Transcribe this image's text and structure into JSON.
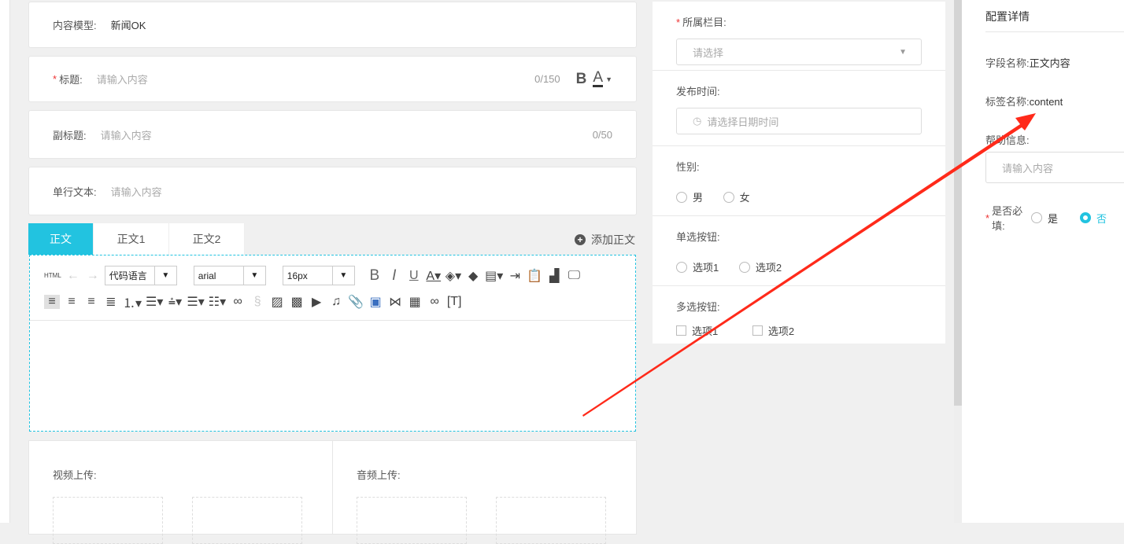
{
  "left": {
    "content_model": {
      "label": "内容模型:",
      "value": "新闻OK"
    },
    "title": {
      "label": "标题:",
      "placeholder": "请输入内容",
      "count": "0/150",
      "bold": "B",
      "color": "A"
    },
    "subtitle": {
      "label": "副标题:",
      "placeholder": "请输入内容",
      "count": "0/50"
    },
    "single_text": {
      "label": "单行文本:",
      "placeholder": "请输入内容"
    },
    "tabs": [
      "正文",
      "正文1",
      "正文2"
    ],
    "add_body": "添加正文",
    "toolbar": {
      "html": "HTML",
      "code_lang": "代码语言",
      "font": "arial",
      "size": "16px"
    },
    "video_upload": "视频上传:",
    "audio_upload": "音频上传:"
  },
  "middle": {
    "column": {
      "label": "所属栏目:",
      "placeholder": "请选择"
    },
    "publish_time": {
      "label": "发布时间:",
      "placeholder": "请选择日期时间"
    },
    "gender": {
      "label": "性别:",
      "options": [
        "男",
        "女"
      ]
    },
    "radio": {
      "label": "单选按钮:",
      "options": [
        "选项1",
        "选项2"
      ]
    },
    "checkbox": {
      "label": "多选按钮:",
      "options": [
        "选项1",
        "选项2"
      ]
    }
  },
  "right": {
    "title": "配置详情",
    "field_name_label": "字段名称:",
    "field_name": "正文内容",
    "tag_name_label": "标签名称:",
    "tag_name": "content",
    "help_label": "帮助信息:",
    "help_placeholder": "请输入内容",
    "required_label": "是否必填:",
    "required_options": [
      "是",
      "否"
    ]
  },
  "colors": {
    "accent": "#22c3e0",
    "arrow": "#ff2a1a"
  }
}
